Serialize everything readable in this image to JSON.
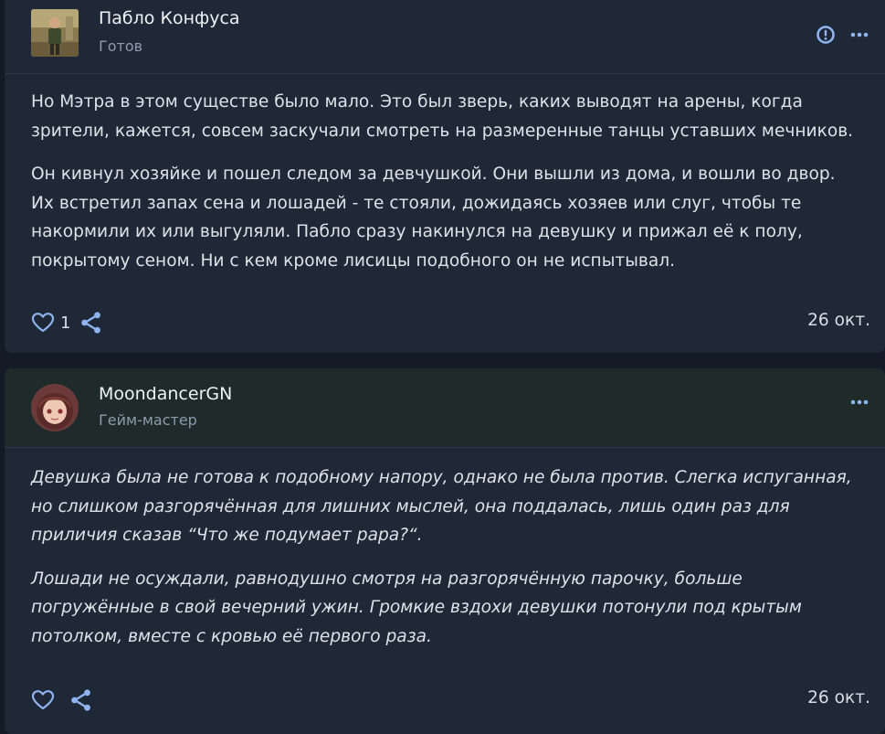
{
  "posts": [
    {
      "author": "Пабло Конфуса",
      "status": "Готов",
      "paragraphs": [
        "Но Мэтра в этом существе было мало. Это был зверь, каких выводят на арены, когда\nзрители, кажется, совсем заскучали смотреть на размеренные танцы уставших мечников.",
        "Он кивнул хозяйке и пошел следом за девчушкой. Они вышли из дома, и вошли во двор.\nИх встретил запах сена и лошадей - те стояли, дожидаясь хозяев или слуг, чтобы те\nнакормили их или выгуляли. Пабло сразу накинулся на девушку и прижал её к полу,\nпокрытому сеном. Ни с кем кроме лисицы подобного он не испытывал."
      ],
      "likes": "1",
      "date": "26 окт.",
      "icons": [
        "report-icon",
        "more-icon",
        "heart-icon",
        "share-icon"
      ]
    },
    {
      "author": "MoondancerGN",
      "status": "Гейм-мастер",
      "paragraphs": [
        "Девушка была не готова к подобному напору, однако не была против. Слегка испуганная,\nно слишком разгорячённая для лишних мыслей, она поддалась, лишь один раз для\nприличия сказав “Что же подумает papa?“.",
        "Лошади не осуждали, равнодушно смотря на разгорячённую парочку, больше\nпогружённые в свой вечерний ужин. Громкие вздохи девушки потонули под крытым\nпотолком, вместе с кровью её первого раза."
      ],
      "likes": "",
      "date": "26 окт.",
      "icons": [
        "more-icon",
        "heart-icon",
        "share-icon"
      ]
    }
  ],
  "colors": {
    "page_bg": "#141b26",
    "card_bg": "#1f2836",
    "gm_header_bg": "#1e2b2a",
    "accent": "#8fb4f0",
    "text": "#dde2e9",
    "muted": "#8f9aab"
  }
}
